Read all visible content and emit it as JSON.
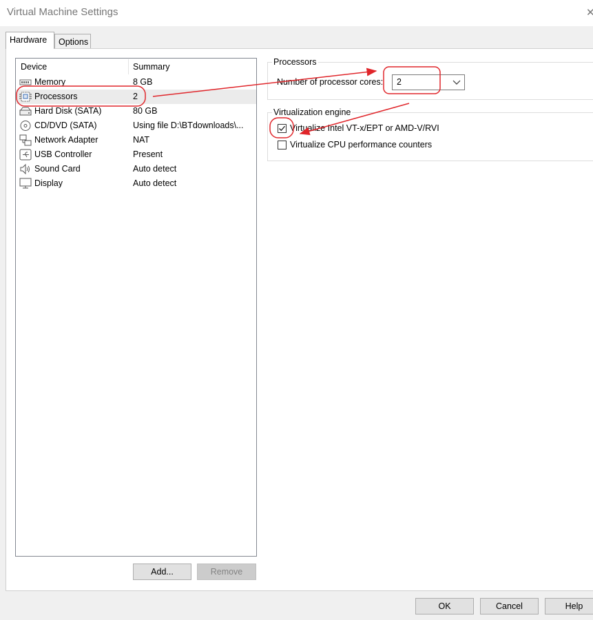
{
  "window": {
    "title": "Virtual Machine Settings"
  },
  "tabs": [
    {
      "label": "Hardware",
      "active": true
    },
    {
      "label": "Options",
      "active": false
    }
  ],
  "device_list": {
    "columns": [
      "Device",
      "Summary"
    ],
    "rows": [
      {
        "name": "Memory",
        "summary": "8 GB",
        "icon": "memory-icon"
      },
      {
        "name": "Processors",
        "summary": "2",
        "icon": "processor-icon",
        "selected": true
      },
      {
        "name": "Hard Disk (SATA)",
        "summary": "80 GB",
        "icon": "hard-disk-icon"
      },
      {
        "name": "CD/DVD (SATA)",
        "summary": "Using file D:\\BTdownloads\\...",
        "icon": "cd-dvd-icon"
      },
      {
        "name": "Network Adapter",
        "summary": "NAT",
        "icon": "network-adapter-icon"
      },
      {
        "name": "USB Controller",
        "summary": "Present",
        "icon": "usb-icon"
      },
      {
        "name": "Sound Card",
        "summary": "Auto detect",
        "icon": "speaker-icon"
      },
      {
        "name": "Display",
        "summary": "Auto detect",
        "icon": "monitor-icon"
      }
    ]
  },
  "list_buttons": {
    "add": "Add...",
    "remove": "Remove"
  },
  "processors_group": {
    "title": "Processors",
    "cores_label": "Number of processor cores:",
    "cores_value": "2"
  },
  "virtualization_group": {
    "title": "Virtualization engine",
    "options": [
      {
        "label": "Virtualize Intel VT-x/EPT or AMD-V/RVI",
        "checked": true
      },
      {
        "label": "Virtualize CPU performance counters",
        "checked": false
      }
    ]
  },
  "footer": {
    "ok": "OK",
    "cancel": "Cancel",
    "help": "Help"
  },
  "colors": {
    "annotation": "#e0252a",
    "selection": "#ebebeb"
  }
}
